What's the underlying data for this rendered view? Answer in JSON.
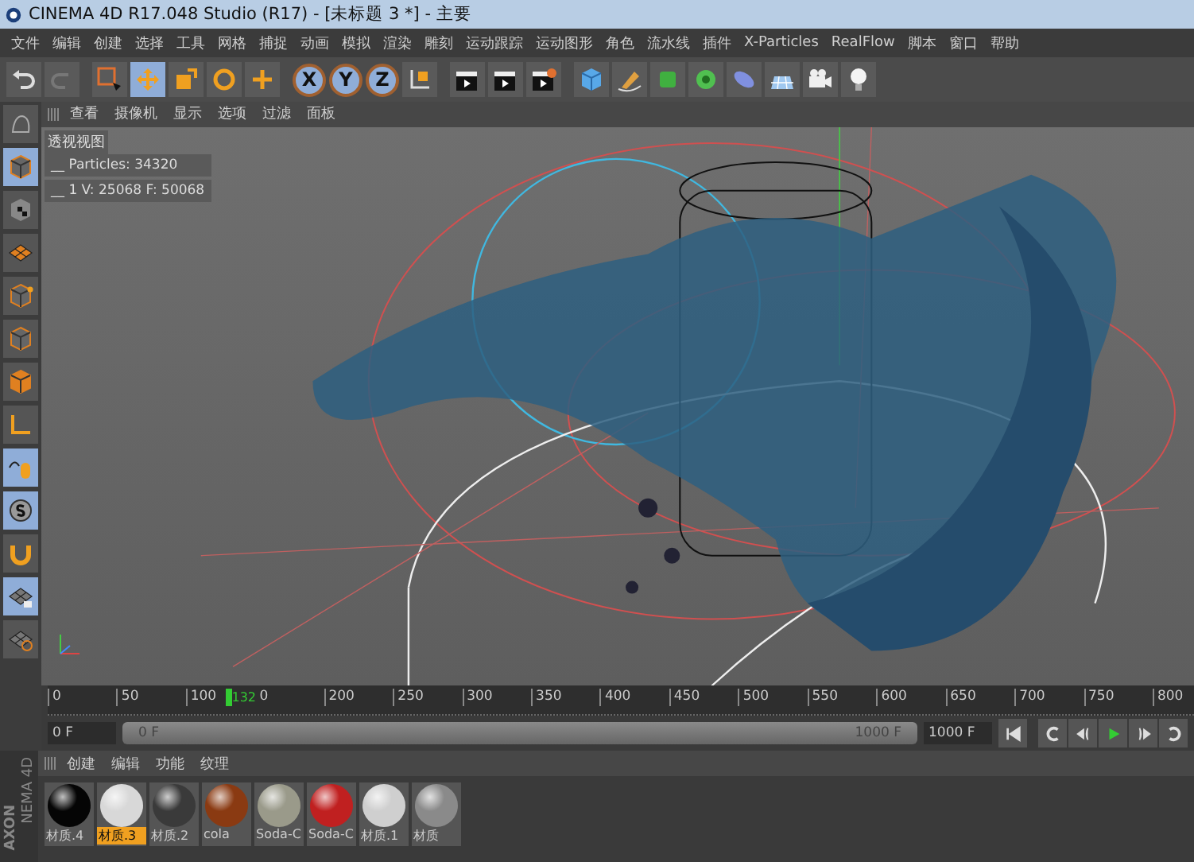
{
  "window": {
    "title": "CINEMA 4D R17.048 Studio (R17) - [未标题 3 *] - 主要"
  },
  "menu": [
    "文件",
    "编辑",
    "创建",
    "选择",
    "工具",
    "网格",
    "捕捉",
    "动画",
    "模拟",
    "渲染",
    "雕刻",
    "运动跟踪",
    "运动图形",
    "角色",
    "流水线",
    "插件",
    "X-Particles",
    "RealFlow",
    "脚本",
    "窗口",
    "帮助"
  ],
  "toolbar": [
    {
      "kind": "undo",
      "selected": false
    },
    {
      "kind": "redo",
      "selected": false
    },
    {
      "kind": "select",
      "selected": false
    },
    {
      "kind": "move",
      "selected": true
    },
    {
      "kind": "scale",
      "selected": false
    },
    {
      "kind": "rotate",
      "selected": false
    },
    {
      "kind": "add",
      "selected": false
    },
    {
      "kind": "axis",
      "label": "X",
      "selected": true
    },
    {
      "kind": "axis",
      "label": "Y",
      "selected": true
    },
    {
      "kind": "axis",
      "label": "Z",
      "selected": true
    },
    {
      "kind": "coords",
      "selected": false
    },
    {
      "kind": "clapper",
      "selected": false
    },
    {
      "kind": "clapper",
      "selected": false
    },
    {
      "kind": "clapper-gear",
      "selected": false
    },
    {
      "kind": "cube",
      "selected": false
    },
    {
      "kind": "pen",
      "selected": false
    },
    {
      "kind": "subdivide",
      "selected": false
    },
    {
      "kind": "cloner",
      "selected": false
    },
    {
      "kind": "deformer",
      "selected": false
    },
    {
      "kind": "floor",
      "selected": false
    },
    {
      "kind": "camera",
      "selected": false
    },
    {
      "kind": "light",
      "selected": false
    }
  ],
  "left_tools": [
    {
      "kind": "sculpt",
      "selected": false
    },
    {
      "kind": "model",
      "selected": true
    },
    {
      "kind": "texture",
      "selected": false
    },
    {
      "kind": "workplane",
      "selected": false
    },
    {
      "kind": "points",
      "selected": false
    },
    {
      "kind": "edges",
      "selected": false
    },
    {
      "kind": "polygons",
      "selected": false
    },
    {
      "kind": "axis",
      "selected": false
    },
    {
      "kind": "tweak",
      "selected": true
    },
    {
      "kind": "snap",
      "selected": true
    },
    {
      "kind": "magnet",
      "selected": false
    },
    {
      "kind": "lock",
      "selected": true
    },
    {
      "kind": "grid",
      "selected": false
    }
  ],
  "viewport": {
    "menu": [
      "查看",
      "摄像机",
      "显示",
      "选项",
      "过滤",
      "面板"
    ],
    "name": "透视视图",
    "hud": [
      "__ Particles: 34320",
      "__ 1 V: 25068 F: 50068"
    ]
  },
  "timeline": {
    "ticks": [
      "0",
      "50",
      "100",
      "0",
      "200",
      "250",
      "300",
      "350",
      "400",
      "450",
      "500",
      "550",
      "600",
      "650",
      "700",
      "750",
      "800"
    ],
    "playhead": {
      "label": "132",
      "level": 0.155
    },
    "start": "0 F",
    "range": {
      "start": "0 F",
      "end": "1000 F",
      "level": 1
    },
    "end": "1000 F",
    "controls": [
      {
        "kind": "first"
      },
      {
        "kind": "back"
      },
      {
        "kind": "prev-key"
      },
      {
        "kind": "play"
      },
      {
        "kind": "next-key"
      },
      {
        "kind": "forward"
      }
    ]
  },
  "materials": {
    "menu": [
      "创建",
      "编辑",
      "功能",
      "纹理"
    ],
    "brand": [
      "AXON",
      "NEMA 4D"
    ],
    "items": [
      {
        "name": "材质.4",
        "color": "#050505",
        "selected": false
      },
      {
        "name": "材质.3",
        "color": "#d8d8d8",
        "selected": true
      },
      {
        "name": "材质.2",
        "color": "#3a3a3a",
        "selected": false
      },
      {
        "name": "cola",
        "color": "#8a3a12",
        "selected": false
      },
      {
        "name": "Soda-C",
        "color": "#9a9a8a",
        "selected": false
      },
      {
        "name": "Soda-C",
        "color": "#c02020",
        "selected": false
      },
      {
        "name": "材质.1",
        "color": "#cfcfcf",
        "selected": false
      },
      {
        "name": "材质",
        "color": "#8a8a8a",
        "selected": false
      }
    ]
  }
}
